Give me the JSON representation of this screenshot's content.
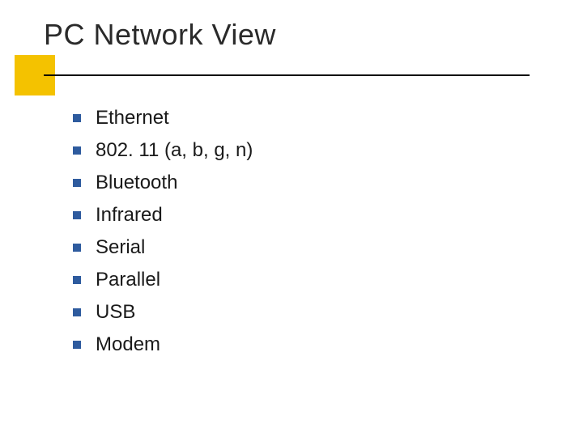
{
  "slide": {
    "title": "PC Network View",
    "bullets": [
      {
        "text": "Ethernet"
      },
      {
        "text": "802. 11 (a, b, g, n)"
      },
      {
        "text": "Bluetooth"
      },
      {
        "text": "Infrared"
      },
      {
        "text": "Serial"
      },
      {
        "text": "Parallel"
      },
      {
        "text": "USB"
      },
      {
        "text": "Modem"
      }
    ]
  },
  "colors": {
    "accent": "#f4c200",
    "bullet": "#2e5b9e"
  }
}
